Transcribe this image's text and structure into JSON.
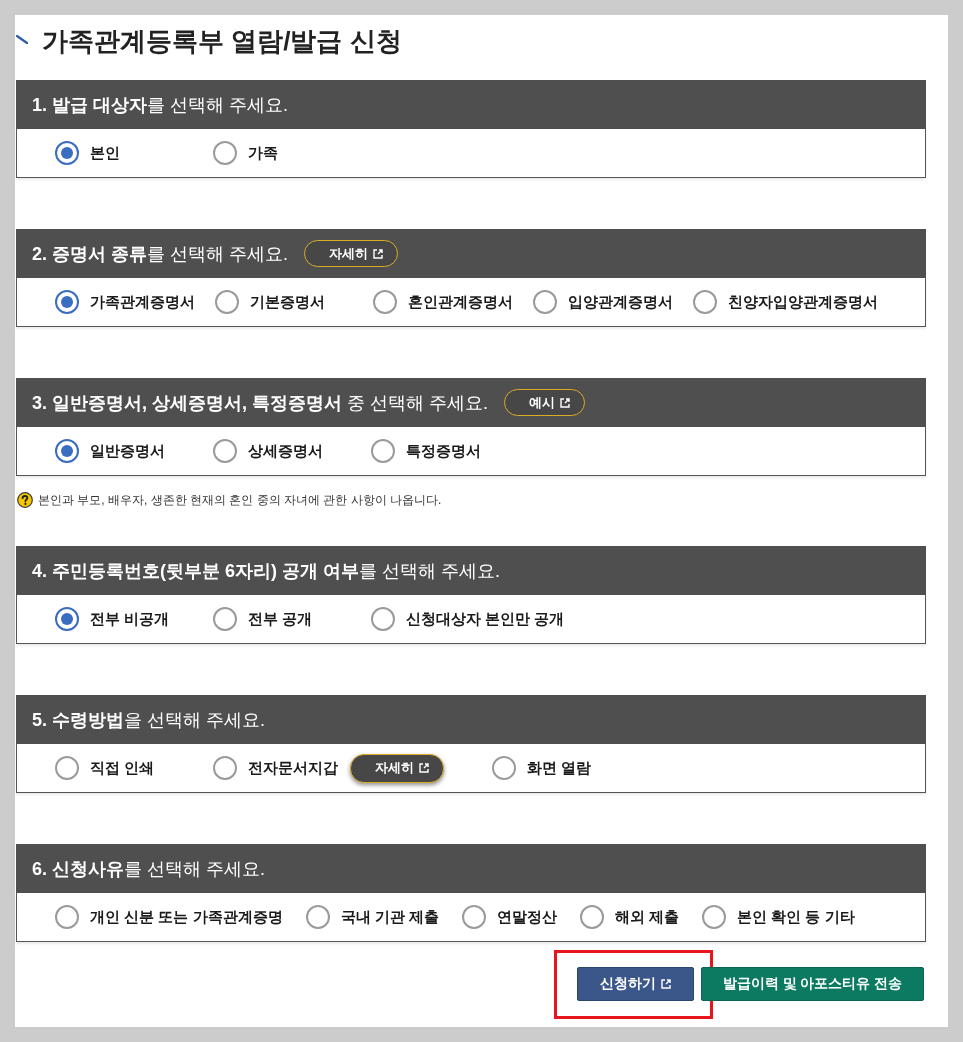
{
  "title": "가족관계등록부 열람/발급 신청",
  "sections": [
    {
      "heading": "**1. 발급 대상자**를 선택해 주세요.",
      "kind": "columns",
      "options": [
        {
          "label": "본인",
          "selected": true
        },
        {
          "label": "가족",
          "selected": false
        }
      ]
    },
    {
      "heading": "**2. 증명서 종류**를 선택해 주세요.",
      "kind": "columns",
      "header_button": {
        "label": "자세히"
      },
      "options": [
        {
          "label": "가족관계증명서",
          "selected": true
        },
        {
          "label": "기본증명서",
          "selected": false
        },
        {
          "label": "혼인관계증명서",
          "selected": false
        },
        {
          "label": "입양관계증명서",
          "selected": false
        },
        {
          "label": "친양자입양관계증명서",
          "selected": false
        }
      ]
    },
    {
      "heading": "**3. 일반증명서, 상세증명서, 특정증명서** 중 선택해 주세요.",
      "kind": "columns",
      "header_button": {
        "label": "예시"
      },
      "options": [
        {
          "label": "일반증명서",
          "selected": true
        },
        {
          "label": "상세증명서",
          "selected": false
        },
        {
          "label": "특정증명서",
          "selected": false
        }
      ],
      "note": "본인과 부모, 배우자, 생존한 현재의 혼인 중의 자녀에 관한 사항이 나옵니다."
    },
    {
      "heading": "**4. 주민등록번호(뒷부분 6자리) 공개 여부**를 선택해 주세요.",
      "kind": "columns",
      "options": [
        {
          "label": "전부 비공개",
          "selected": true
        },
        {
          "label": "전부 공개",
          "selected": false
        },
        {
          "label": "신청대상자 본인만 공개",
          "selected": false
        }
      ]
    },
    {
      "heading": "**5. 수령방법**을 선택해 주세요.",
      "kind": "columns",
      "options": [
        {
          "label": "직접 인쇄",
          "selected": false
        },
        {
          "label": "전자문서지갑",
          "selected": false,
          "button": {
            "label": "자세히"
          }
        },
        {
          "label": "화면 열람",
          "selected": false
        }
      ]
    },
    {
      "heading": "**6. 신청사유**를 선택해 주세요.",
      "kind": "flow",
      "options": [
        {
          "label": "개인 신분 또는 가족관계증명",
          "selected": false
        },
        {
          "label": "국내 기관 제출",
          "selected": false
        },
        {
          "label": "연말정산",
          "selected": false
        },
        {
          "label": "해외 제출",
          "selected": false
        },
        {
          "label": "본인 확인 등 기타",
          "selected": false
        }
      ]
    }
  ],
  "actions": [
    {
      "label": "신청하기",
      "kind": "primary",
      "highlighted": true
    },
    {
      "label": "발급이력 및 아포스티유 전송",
      "kind": "secondary"
    }
  ]
}
